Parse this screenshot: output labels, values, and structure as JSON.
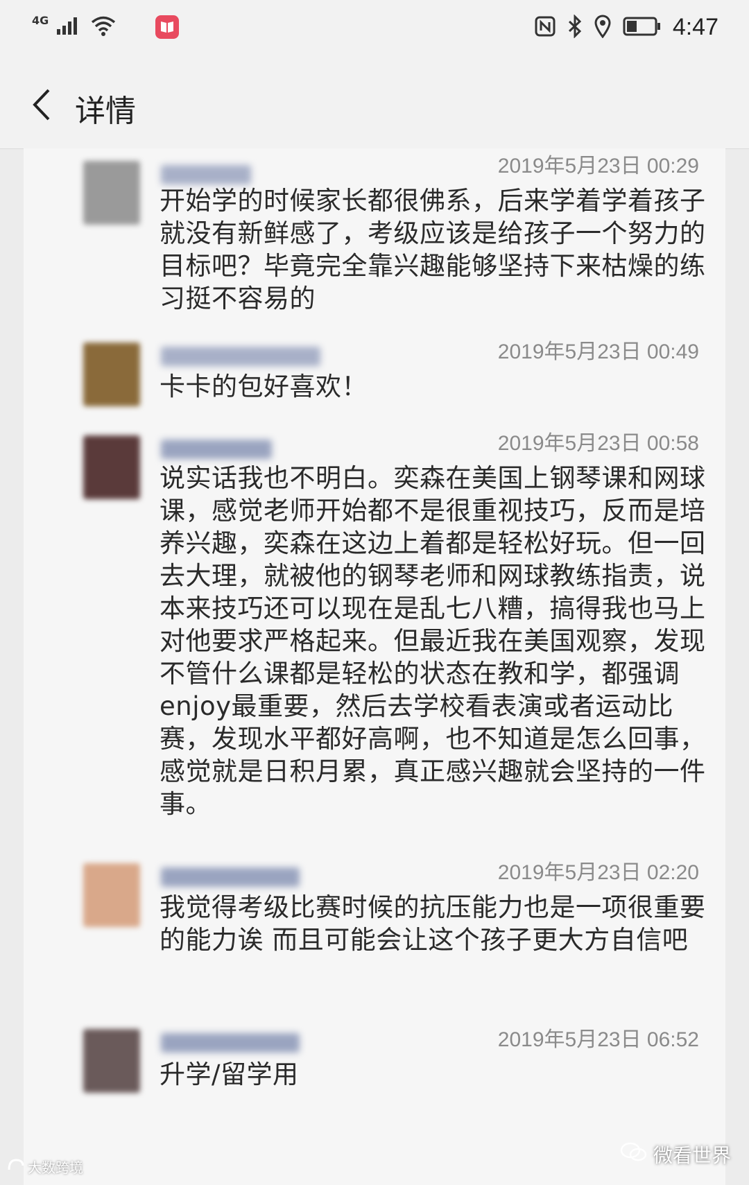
{
  "status_bar": {
    "network": "4G",
    "time": "4:47",
    "icons": [
      "signal-icon",
      "wifi-icon",
      "reader-app-icon",
      "nfc-icon",
      "bluetooth-icon",
      "location-icon",
      "battery-icon"
    ]
  },
  "header": {
    "title": "详情"
  },
  "comments": [
    {
      "timestamp": "2019年5月23日 00:29",
      "text": "开始学的时候家长都很佛系，后来学着学着孩子就没有新鲜感了，考级应该是给孩子一个努力的目标吧？毕竟完全靠兴趣能够坚持下来枯燥的练习挺不容易的",
      "avatar_color": "#9a9a9a"
    },
    {
      "timestamp": "2019年5月23日 00:49",
      "text": "卡卡的包好喜欢！",
      "avatar_color": "#8a6a3a"
    },
    {
      "timestamp": "2019年5月23日 00:58",
      "text": "说实话我也不明白。奕森在美国上钢琴课和网球课，感觉老师开始都不是很重视技巧，反而是培养兴趣，奕森在这边上着都是轻松好玩。但一回去大理，就被他的钢琴老师和网球教练指责，说本来技巧还可以现在是乱七八糟，搞得我也马上对他要求严格起来。但最近我在美国观察，发现不管什么课都是轻松的状态在教和学，都强调enjoy最重要，然后去学校看表演或者运动比赛，发现水平都好高啊，也不知道是怎么回事，感觉就是日积月累，真正感兴趣就会坚持的一件事。",
      "avatar_color": "#5a3a3a"
    },
    {
      "timestamp": "2019年5月23日 02:20",
      "text": "我觉得考级比赛时候的抗压能力也是一项很重要的能力诶 而且可能会让这个孩子更大方自信吧",
      "avatar_color": "#d9a88a"
    },
    {
      "timestamp": "2019年5月23日 06:52",
      "text": "升学/留学用",
      "avatar_color": "#6a5a5a"
    }
  ],
  "watermarks": {
    "left": "大数跨境",
    "right": "微看世界"
  }
}
